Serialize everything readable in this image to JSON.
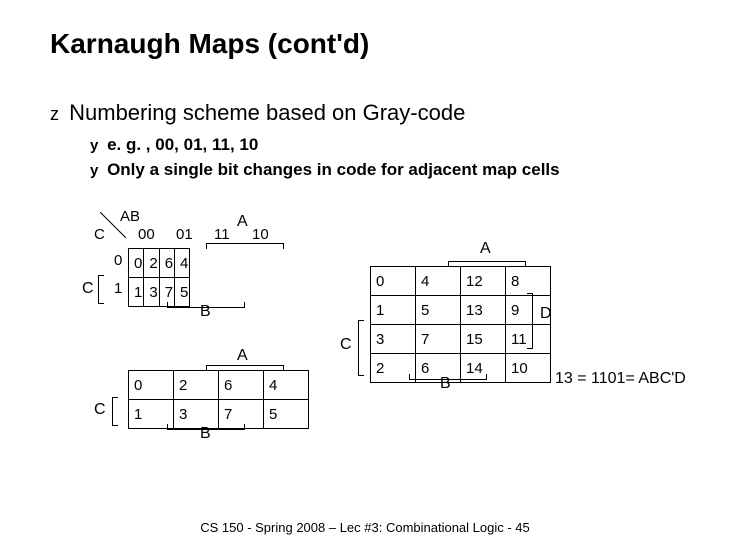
{
  "title": "Karnaugh Maps (cont'd)",
  "bullet_main": "Numbering scheme based on Gray-code",
  "sub1": "e. g. , 00, 01, 11, 10",
  "sub2": "Only a single bit changes in code for adjacent map cells",
  "glyph_z": "z",
  "glyph_y": "y",
  "kmap1": {
    "ab": "AB",
    "c": "C",
    "cols": [
      "00",
      "01",
      "11",
      "10"
    ],
    "rows": [
      "0",
      "1"
    ],
    "cells": [
      [
        "0",
        "2",
        "6",
        "4"
      ],
      [
        "1",
        "3",
        "7",
        "5"
      ]
    ],
    "A": "A",
    "B": "B",
    "Cvar": "C"
  },
  "kmap2": {
    "cells": [
      [
        "0",
        "2",
        "6",
        "4"
      ],
      [
        "1",
        "3",
        "7",
        "5"
      ]
    ],
    "A": "A",
    "B": "B",
    "Cvar": "C"
  },
  "kmap4": {
    "cells": [
      [
        "0",
        "4",
        "12",
        "8"
      ],
      [
        "1",
        "5",
        "13",
        "9"
      ],
      [
        "3",
        "7",
        "15",
        "11"
      ],
      [
        "2",
        "6",
        "14",
        "10"
      ]
    ],
    "A": "A",
    "B": "B",
    "Cvar": "C",
    "D": "D"
  },
  "annotation": "13 = 1101= ABC'D",
  "footer": "CS 150 - Spring 2008 – Lec #3: Combinational Logic - 45"
}
